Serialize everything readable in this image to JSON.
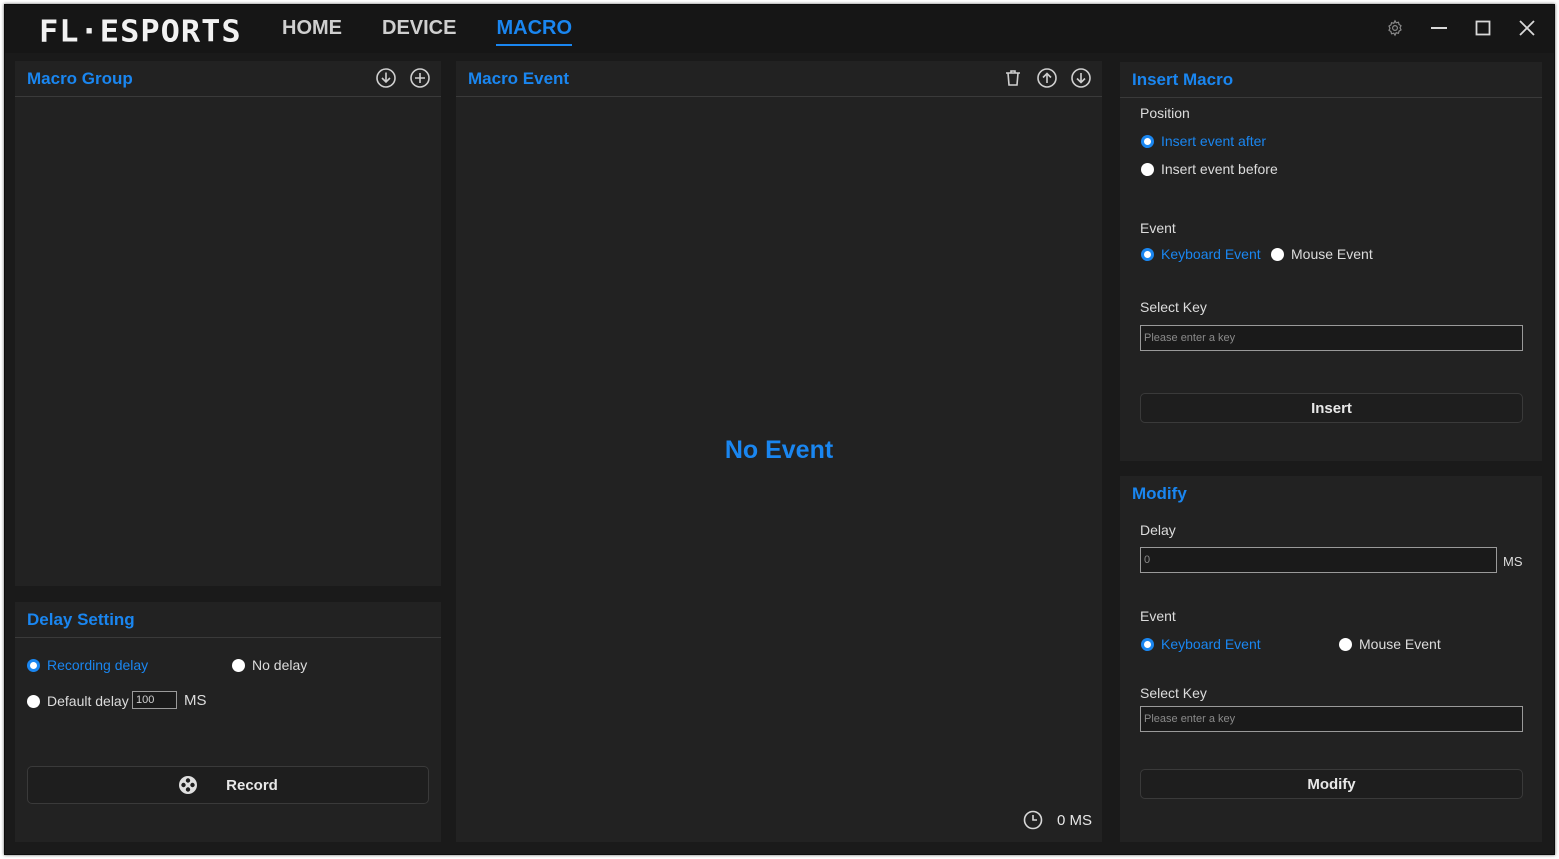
{
  "app": {
    "logo": "FL·ESPORTS",
    "nav": [
      {
        "label": "HOME",
        "active": false
      },
      {
        "label": "DEVICE",
        "active": false
      },
      {
        "label": "MACRO",
        "active": true
      }
    ],
    "accent_color": "#1a86f0"
  },
  "macro_group": {
    "title": "Macro Group",
    "icons": [
      "download-icon",
      "add-icon"
    ]
  },
  "delay_setting": {
    "title": "Delay Setting",
    "recording_delay": "Recording delay",
    "no_delay": "No delay",
    "default_delay": "Default delay",
    "default_delay_value": "100",
    "unit": "MS",
    "record_button": "Record"
  },
  "macro_event": {
    "title": "Macro Event",
    "icons": [
      "trash-icon",
      "move-up-icon",
      "move-down-icon"
    ],
    "empty_text": "No Event",
    "total_time": "0 MS"
  },
  "insert_macro": {
    "title": "Insert Macro",
    "position_label": "Position",
    "insert_after": "Insert event after",
    "insert_before": "Insert event before",
    "event_label": "Event",
    "keyboard_event": "Keyboard Event",
    "mouse_event": "Mouse Event",
    "select_key_label": "Select Key",
    "key_placeholder": "Please enter a key",
    "insert_button": "Insert"
  },
  "modify": {
    "title": "Modify",
    "delay_label": "Delay",
    "delay_value": "0",
    "unit": "MS",
    "event_label": "Event",
    "keyboard_event": "Keyboard Event",
    "mouse_event": "Mouse Event",
    "select_key_label": "Select Key",
    "key_placeholder": "Please enter a key",
    "modify_button": "Modify"
  }
}
